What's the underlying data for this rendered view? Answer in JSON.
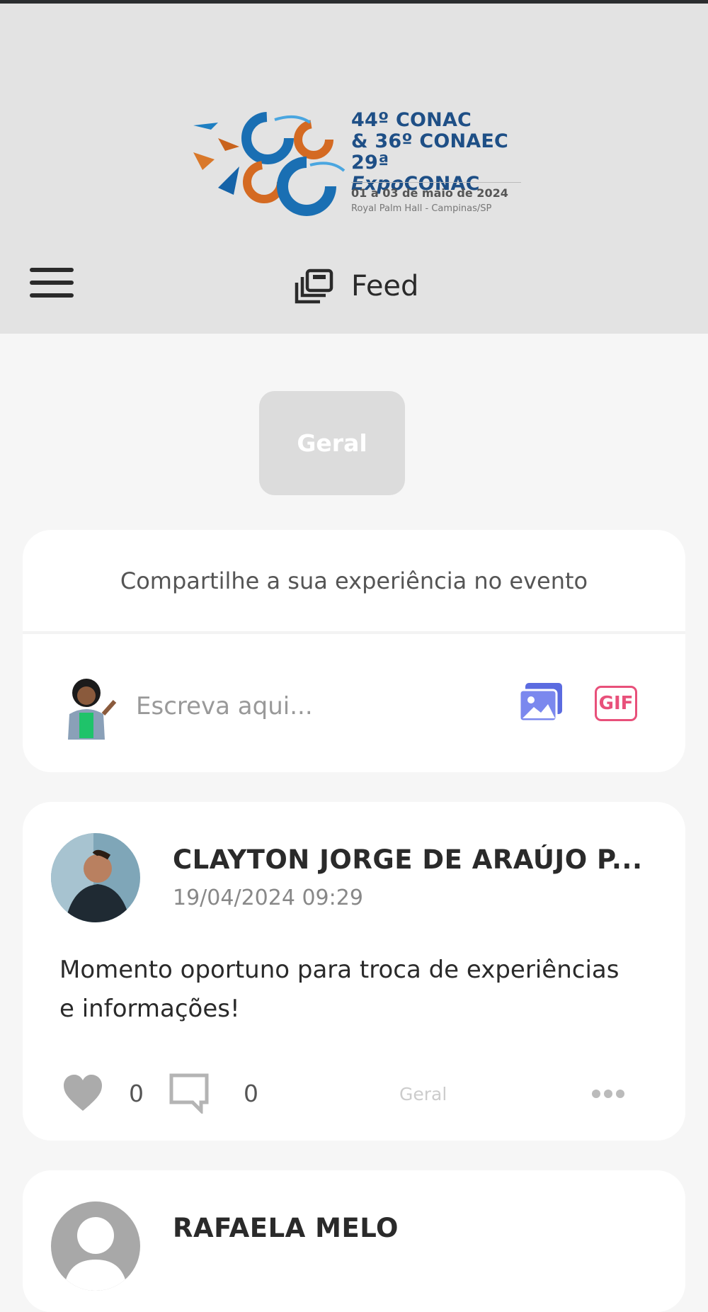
{
  "header": {
    "logo": {
      "line1": "44º CONAC",
      "line2": "& 36º CONAEC",
      "line3_prefix": "29ª ",
      "line3_italic": "Expo",
      "line3_suffix": "CONAC",
      "date": "01 a 03 de maio de 2024",
      "place": "Royal Palm Hall - Campinas/SP"
    }
  },
  "navbar": {
    "menu_icon": "hamburger-menu-icon",
    "title_icon": "feed-gallery-icon",
    "title": "Feed"
  },
  "filters": {
    "active_tab": "Geral"
  },
  "composer": {
    "title": "Compartilhe a sua experiência no evento",
    "placeholder": "Escreva aqui...",
    "image_icon": "image-icon",
    "gif_label": "GIF"
  },
  "posts": [
    {
      "author": "CLAYTON JORGE DE ARAÚJO P...",
      "timestamp": "19/04/2024 09:29",
      "body": "Momento oportuno para troca de experiências e informações!",
      "likes": "0",
      "comments": "0",
      "category": "Geral"
    },
    {
      "author": "RAFAELA MELO"
    }
  ],
  "colors": {
    "banner_bg": "#e3e3e3",
    "page_bg": "#f6f6f6",
    "image_icon": "#5b6be0",
    "gif": "#e8507a"
  }
}
